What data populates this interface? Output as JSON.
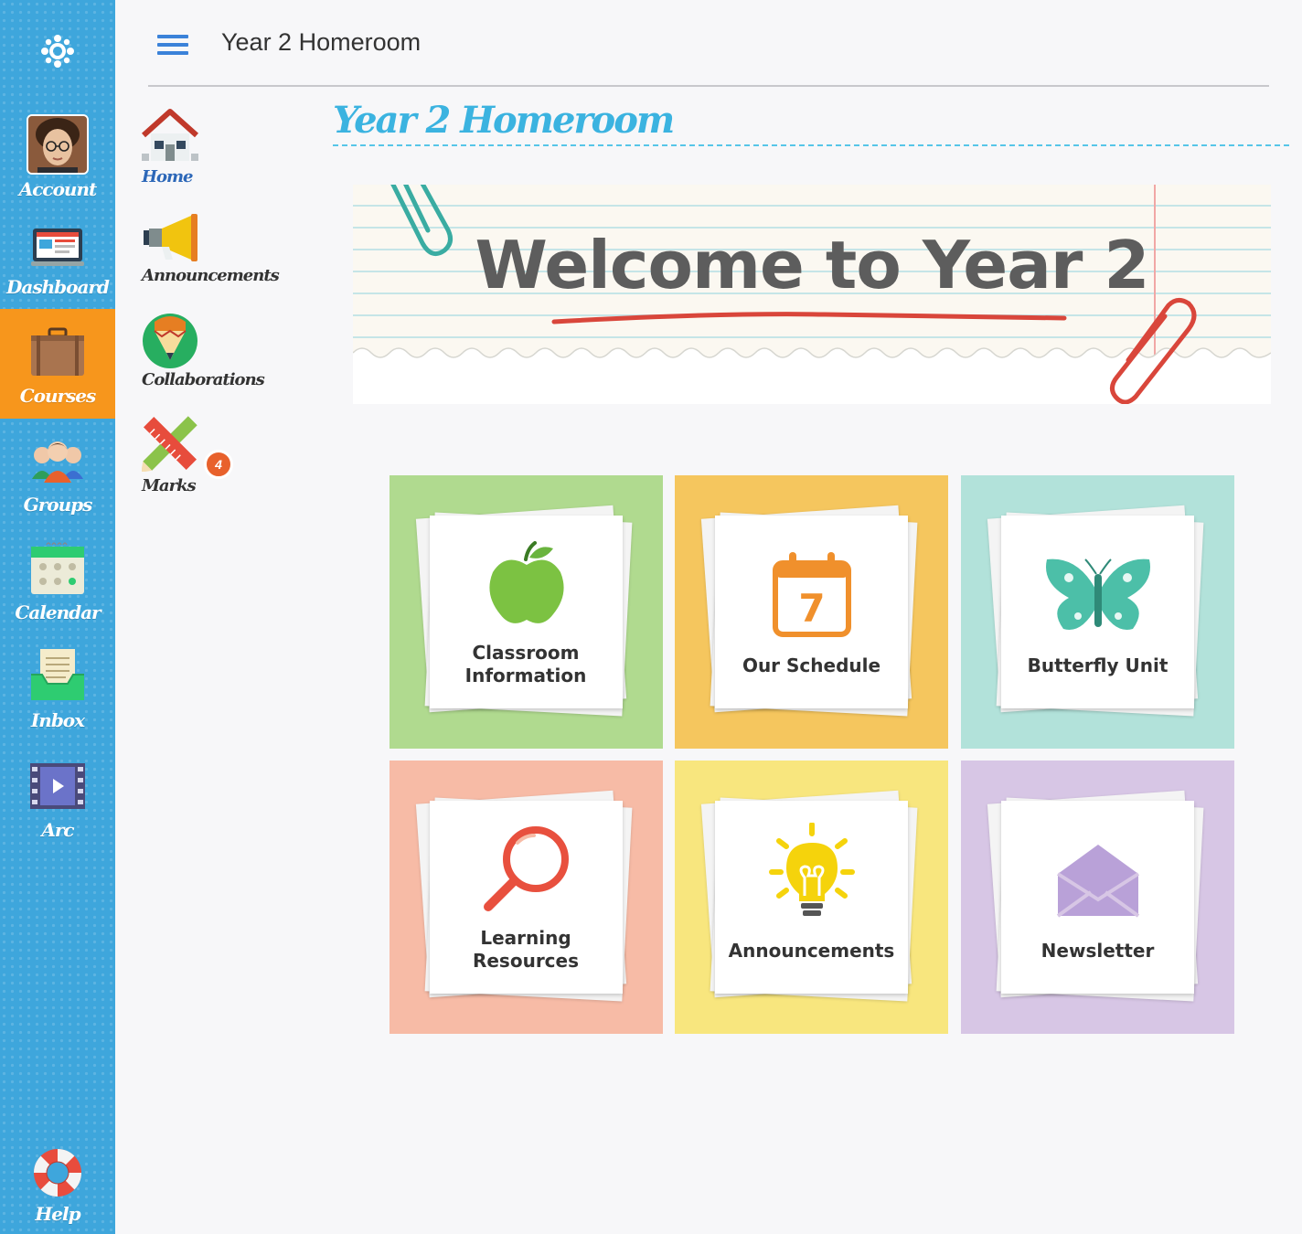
{
  "global_nav": {
    "items": [
      {
        "label": "Account",
        "icon": "account-avatar"
      },
      {
        "label": "Dashboard",
        "icon": "dashboard-icon"
      },
      {
        "label": "Courses",
        "icon": "briefcase-icon",
        "active": true
      },
      {
        "label": "Groups",
        "icon": "groups-icon"
      },
      {
        "label": "Calendar",
        "icon": "calendar-icon"
      },
      {
        "label": "Inbox",
        "icon": "inbox-icon"
      },
      {
        "label": "Arc",
        "icon": "film-icon"
      },
      {
        "label": "Help",
        "icon": "lifebuoy-icon"
      }
    ],
    "bg_color": "#3ea6dc",
    "active_color": "#f7961c"
  },
  "header": {
    "breadcrumb": "Year 2 Homeroom"
  },
  "course_nav": {
    "items": [
      {
        "label": "Home",
        "icon": "house-icon"
      },
      {
        "label": "Announcements",
        "icon": "megaphone-icon"
      },
      {
        "label": "Collaborations",
        "icon": "pencil-badge-icon"
      },
      {
        "label": "Marks",
        "icon": "pencil-ruler-icon",
        "badge": "4"
      }
    ]
  },
  "main": {
    "title": "Year 2 Homeroom",
    "banner_text": "Welcome to Year 2",
    "tiles": [
      {
        "label": "Classroom Information",
        "icon": "apple-icon",
        "color": "#b0da8f"
      },
      {
        "label": "Our Schedule",
        "icon": "calendar-7-icon",
        "color": "#f5c65e",
        "day": "7"
      },
      {
        "label": "Butterfly Unit",
        "icon": "butterfly-icon",
        "color": "#b2e2da"
      },
      {
        "label": "Learning Resources",
        "icon": "magnifier-icon",
        "color": "#f7bba6"
      },
      {
        "label": "Announcements",
        "icon": "lightbulb-icon",
        "color": "#f8e67e"
      },
      {
        "label": "Newsletter",
        "icon": "envelope-icon",
        "color": "#d7c6e5"
      }
    ]
  }
}
